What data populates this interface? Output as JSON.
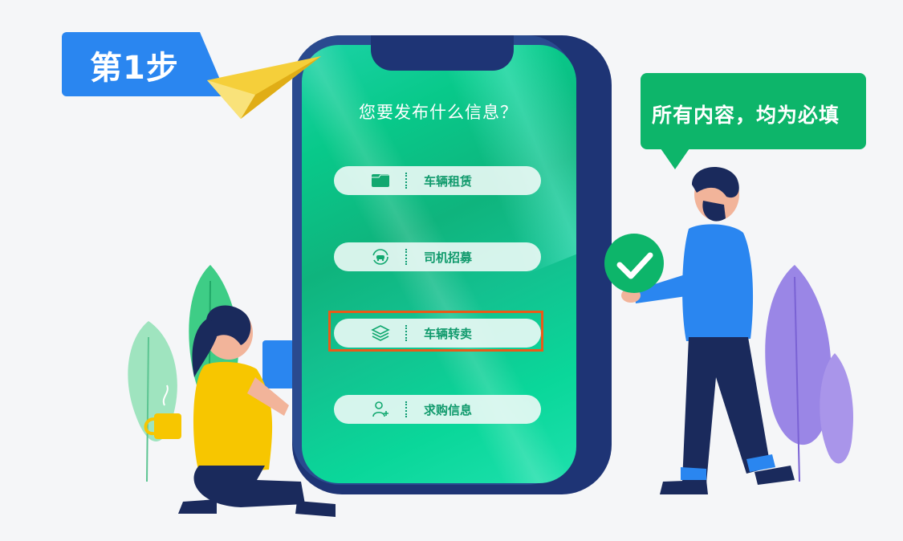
{
  "step": {
    "label": "第1步"
  },
  "screen": {
    "title": "您要发布什么信息？"
  },
  "menu": {
    "items": [
      {
        "label": "车辆租赁",
        "icon": "folder-icon",
        "selected": false
      },
      {
        "label": "司机招募",
        "icon": "car-cycle-icon",
        "selected": false
      },
      {
        "label": "车辆转卖",
        "icon": "layers-icon",
        "selected": true
      },
      {
        "label": "求购信息",
        "icon": "user-add-icon",
        "selected": false
      }
    ]
  },
  "tip": {
    "text": "所有内容，均为必填"
  },
  "colors": {
    "accent_blue": "#2a86f0",
    "screen_green": "#0fb47d",
    "highlight": "#ea5a18",
    "bubble_green": "#0db56a"
  }
}
